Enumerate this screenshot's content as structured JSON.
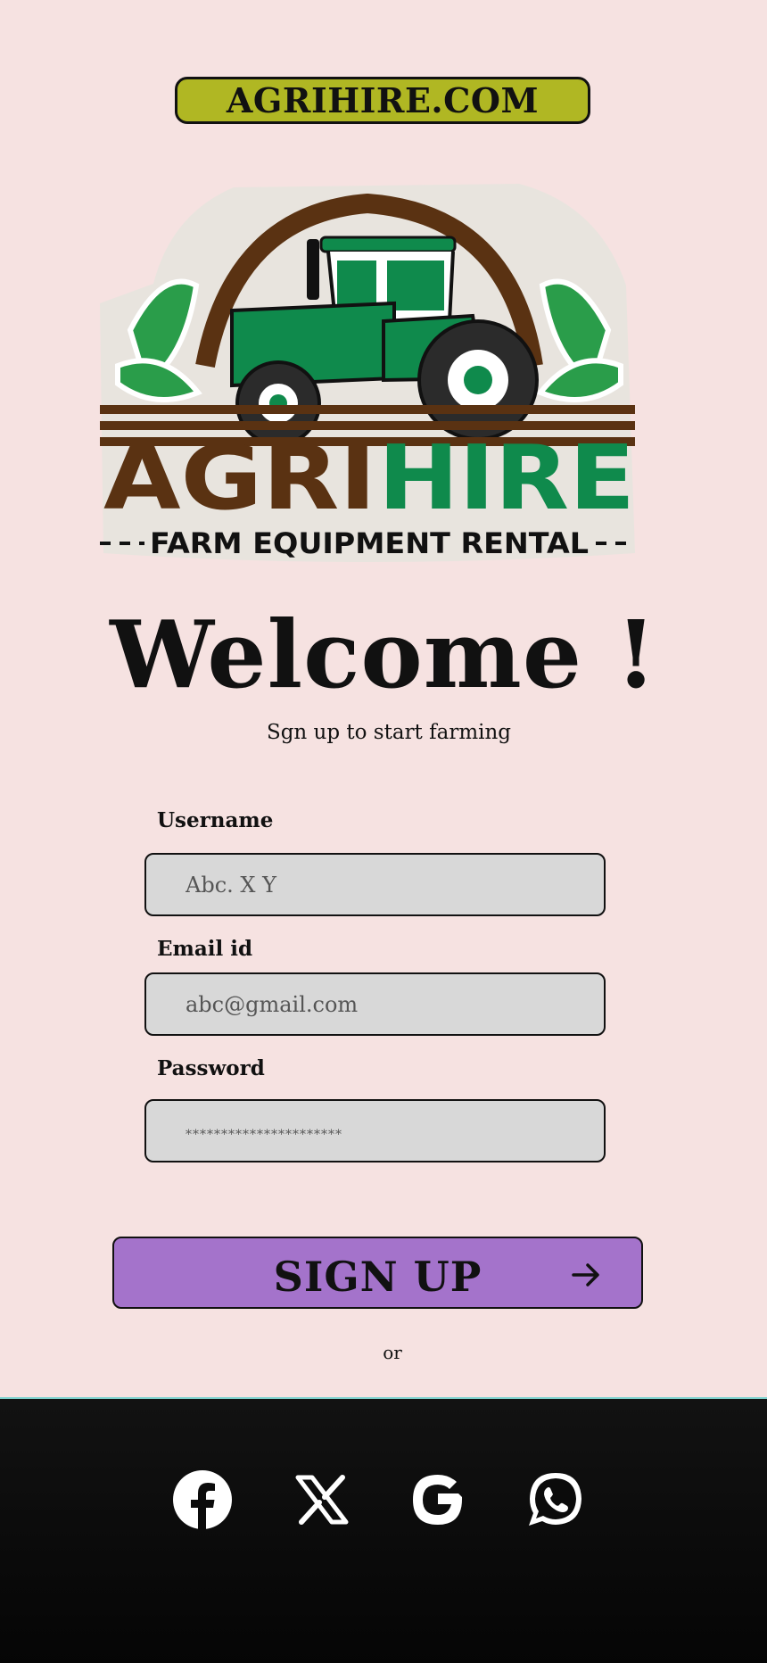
{
  "header": {
    "site_badge": "AGRIHIRE.COM"
  },
  "logo": {
    "brand_part1": "AGRI",
    "brand_part2": "HIRE",
    "tagline": "FARM EQUIPMENT RENTAL",
    "colors": {
      "brown": "#5a3212",
      "green": "#0f8a4c",
      "leaf": "#2a9d4a"
    }
  },
  "welcome": {
    "title": "Welcome !",
    "subtitle": "Sgn up to start farming"
  },
  "form": {
    "username": {
      "label": "Username",
      "placeholder": "Abc. X Y"
    },
    "email": {
      "label": "Email id",
      "placeholder": "abc@gmail.com"
    },
    "password": {
      "label": "Password",
      "placeholder": "**********************"
    },
    "signup_label": "SIGN UP",
    "or_text": "or"
  },
  "social": {
    "icons": [
      "facebook-icon",
      "x-icon",
      "google-icon",
      "whatsapp-icon"
    ]
  },
  "colors": {
    "background": "#f6e2e1",
    "badge": "#b0b723",
    "button": "#a473cb",
    "input": "#d8d8d8",
    "footer": "#0b0b0b"
  }
}
